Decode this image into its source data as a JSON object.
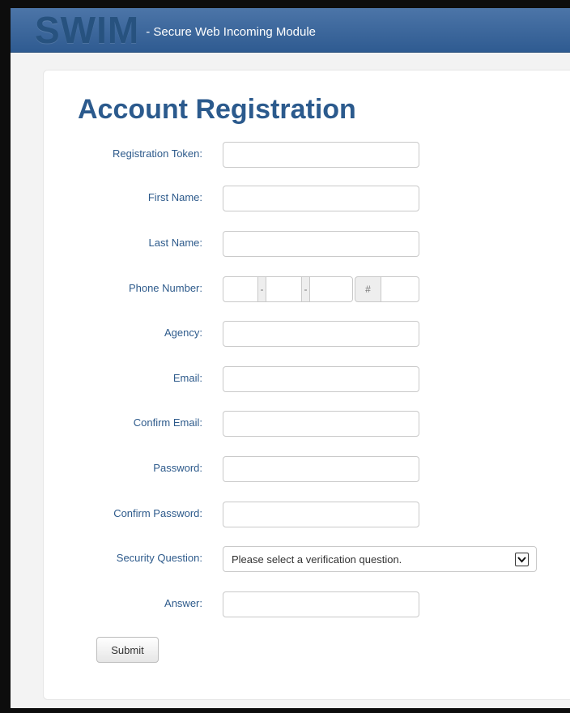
{
  "header": {
    "logo": "SWIM",
    "subtitle": "- Secure Web Incoming Module"
  },
  "page": {
    "title": "Account Registration"
  },
  "form": {
    "registration_token": {
      "label": "Registration Token:",
      "value": ""
    },
    "first_name": {
      "label": "First Name:",
      "value": ""
    },
    "last_name": {
      "label": "Last Name:",
      "value": ""
    },
    "phone_number": {
      "label": "Phone Number:",
      "separator": "-",
      "ext_symbol": "#",
      "area": "",
      "prefix": "",
      "line": "",
      "ext": ""
    },
    "agency": {
      "label": "Agency:",
      "value": ""
    },
    "email": {
      "label": "Email:",
      "value": ""
    },
    "confirm_email": {
      "label": "Confirm Email:",
      "value": ""
    },
    "password": {
      "label": "Password:",
      "value": ""
    },
    "confirm_password": {
      "label": "Confirm Password:",
      "value": ""
    },
    "security_question": {
      "label": "Security Question:",
      "selected": "Please select a verification question."
    },
    "answer": {
      "label": "Answer:",
      "value": ""
    },
    "submit_label": "Submit"
  },
  "colors": {
    "header_bg": "#3a659c",
    "label_text": "#2d5a8b",
    "title_text": "#2b5a8d"
  }
}
